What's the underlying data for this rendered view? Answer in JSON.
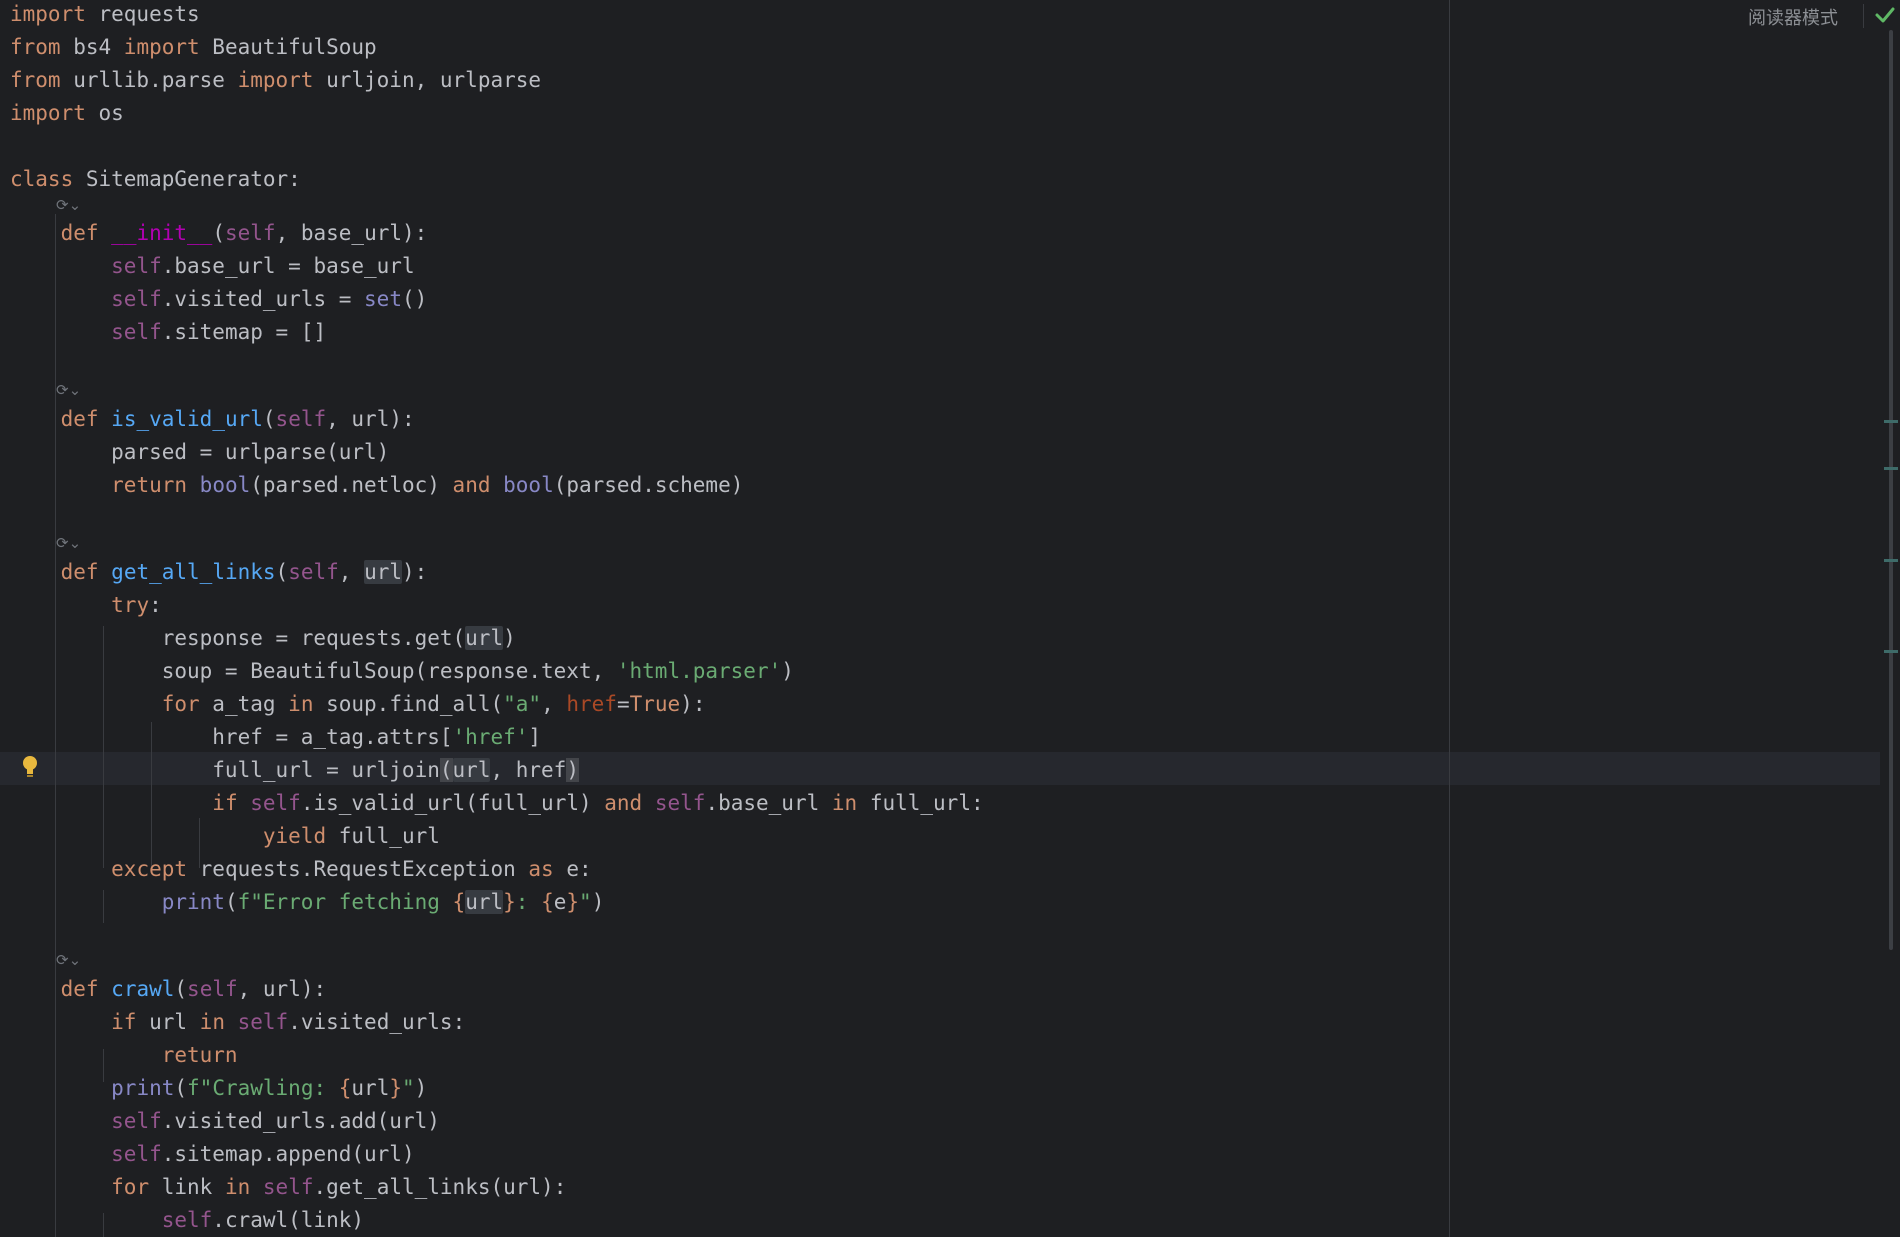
{
  "toolbar": {
    "reader_mode_label": "阅读器模式",
    "inspection_status_icon": "check-icon"
  },
  "colors": {
    "background": "#1e1f22",
    "keyword": "#cf8e6d",
    "self": "#94558d",
    "function": "#56a8f5",
    "magic": "#b200b2",
    "builtin": "#8888c6",
    "string": "#6aab73",
    "param": "#aa4926",
    "text": "#bcbec4"
  },
  "editor": {
    "gutter_icons": [
      "override-method-icon",
      "intention-bulb-icon"
    ],
    "lines": [
      [
        {
          "t": "import",
          "c": "kw"
        },
        {
          "t": " requests"
        }
      ],
      [
        {
          "t": "from",
          "c": "kw"
        },
        {
          "t": " bs4 "
        },
        {
          "t": "import",
          "c": "kw"
        },
        {
          "t": " BeautifulSoup"
        }
      ],
      [
        {
          "t": "from",
          "c": "kw"
        },
        {
          "t": " urllib.parse "
        },
        {
          "t": "import",
          "c": "kw"
        },
        {
          "t": " urljoin, urlparse"
        }
      ],
      [
        {
          "t": "import",
          "c": "kw"
        },
        {
          "t": " os"
        }
      ],
      [
        {
          "t": "class",
          "c": "kw"
        },
        {
          "t": " SitemapGenerator:"
        }
      ],
      [
        {
          "t": "    "
        },
        {
          "t": "def",
          "c": "kw"
        },
        {
          "t": " "
        },
        {
          "t": "__init__",
          "c": "magic"
        },
        {
          "t": "("
        },
        {
          "t": "self",
          "c": "self"
        },
        {
          "t": ", base_url):"
        }
      ],
      [
        {
          "t": "        "
        },
        {
          "t": "self",
          "c": "self"
        },
        {
          "t": ".base_url = base_url"
        }
      ],
      [
        {
          "t": "        "
        },
        {
          "t": "self",
          "c": "self"
        },
        {
          "t": ".visited_urls = "
        },
        {
          "t": "set",
          "c": "builtin"
        },
        {
          "t": "()"
        }
      ],
      [
        {
          "t": "        "
        },
        {
          "t": "self",
          "c": "self"
        },
        {
          "t": ".sitemap = []"
        }
      ],
      [
        {
          "t": "    "
        },
        {
          "t": "def",
          "c": "kw"
        },
        {
          "t": " "
        },
        {
          "t": "is_valid_url",
          "c": "fn"
        },
        {
          "t": "("
        },
        {
          "t": "self",
          "c": "self"
        },
        {
          "t": ", url):"
        }
      ],
      [
        {
          "t": "        parsed = urlparse(url)"
        }
      ],
      [
        {
          "t": "        "
        },
        {
          "t": "return",
          "c": "kw"
        },
        {
          "t": " "
        },
        {
          "t": "bool",
          "c": "builtin"
        },
        {
          "t": "(parsed.netloc) "
        },
        {
          "t": "and",
          "c": "kw"
        },
        {
          "t": " "
        },
        {
          "t": "bool",
          "c": "builtin"
        },
        {
          "t": "(parsed.scheme)"
        }
      ],
      [
        {
          "t": "    "
        },
        {
          "t": "def",
          "c": "kw"
        },
        {
          "t": " "
        },
        {
          "t": "get_all_links",
          "c": "fn"
        },
        {
          "t": "("
        },
        {
          "t": "self",
          "c": "self"
        },
        {
          "t": ", "
        },
        {
          "t": "url",
          "c": "hl"
        },
        {
          "t": "):"
        }
      ],
      [
        {
          "t": "        "
        },
        {
          "t": "try",
          "c": "kw"
        },
        {
          "t": ":"
        }
      ],
      [
        {
          "t": "            response = requests.get("
        },
        {
          "t": "url",
          "c": "hl"
        },
        {
          "t": ")"
        }
      ],
      [
        {
          "t": "            soup = BeautifulSoup(response.text, "
        },
        {
          "t": "'html.parser'",
          "c": "str"
        },
        {
          "t": ")"
        }
      ],
      [
        {
          "t": "            "
        },
        {
          "t": "for",
          "c": "kw"
        },
        {
          "t": " a_tag "
        },
        {
          "t": "in",
          "c": "kw"
        },
        {
          "t": " soup.find_all("
        },
        {
          "t": "\"a\"",
          "c": "str"
        },
        {
          "t": ", "
        },
        {
          "t": "href",
          "c": "param"
        },
        {
          "t": "="
        },
        {
          "t": "True",
          "c": "kw"
        },
        {
          "t": "):"
        }
      ],
      [
        {
          "t": "                href = a_tag.attrs["
        },
        {
          "t": "'href'",
          "c": "str"
        },
        {
          "t": "]"
        }
      ],
      [
        {
          "t": "                full_url = urljoin"
        },
        {
          "t": "(",
          "c": "brace"
        },
        {
          "t": "url",
          "c": "hl"
        },
        {
          "t": ", href"
        },
        {
          "t": ")",
          "c": "brace"
        }
      ],
      [
        {
          "t": "                "
        },
        {
          "t": "if",
          "c": "kw"
        },
        {
          "t": " "
        },
        {
          "t": "self",
          "c": "self"
        },
        {
          "t": ".is_valid_url(full_url) "
        },
        {
          "t": "and",
          "c": "kw"
        },
        {
          "t": " "
        },
        {
          "t": "self",
          "c": "self"
        },
        {
          "t": ".base_url "
        },
        {
          "t": "in",
          "c": "kw"
        },
        {
          "t": " full_url:"
        }
      ],
      [
        {
          "t": "                    "
        },
        {
          "t": "yield",
          "c": "kw"
        },
        {
          "t": " full_url"
        }
      ],
      [
        {
          "t": "        "
        },
        {
          "t": "except",
          "c": "kw"
        },
        {
          "t": " requests.RequestException "
        },
        {
          "t": "as",
          "c": "kw"
        },
        {
          "t": " e:"
        }
      ],
      [
        {
          "t": "            "
        },
        {
          "t": "print",
          "c": "builtin"
        },
        {
          "t": "("
        },
        {
          "t": "f\"Error fetching ",
          "c": "str"
        },
        {
          "t": "{",
          "c": "kw"
        },
        {
          "t": "url",
          "c": "hl"
        },
        {
          "t": "}",
          "c": "kw"
        },
        {
          "t": ": ",
          "c": "str"
        },
        {
          "t": "{",
          "c": "kw"
        },
        {
          "t": "e"
        },
        {
          "t": "}",
          "c": "kw"
        },
        {
          "t": "\"",
          "c": "str"
        },
        {
          "t": ")"
        }
      ],
      [
        {
          "t": "    "
        },
        {
          "t": "def",
          "c": "kw"
        },
        {
          "t": " "
        },
        {
          "t": "crawl",
          "c": "fn"
        },
        {
          "t": "("
        },
        {
          "t": "self",
          "c": "self"
        },
        {
          "t": ", url):"
        }
      ],
      [
        {
          "t": "        "
        },
        {
          "t": "if",
          "c": "kw"
        },
        {
          "t": " url "
        },
        {
          "t": "in",
          "c": "kw"
        },
        {
          "t": " "
        },
        {
          "t": "self",
          "c": "self"
        },
        {
          "t": ".visited_urls:"
        }
      ],
      [
        {
          "t": "            "
        },
        {
          "t": "return",
          "c": "kw"
        }
      ],
      [
        {
          "t": "        "
        },
        {
          "t": "print",
          "c": "builtin"
        },
        {
          "t": "("
        },
        {
          "t": "f\"Crawling: ",
          "c": "str"
        },
        {
          "t": "{",
          "c": "kw"
        },
        {
          "t": "url"
        },
        {
          "t": "}",
          "c": "kw"
        },
        {
          "t": "\"",
          "c": "str"
        },
        {
          "t": ")"
        }
      ],
      [
        {
          "t": "        "
        },
        {
          "t": "self",
          "c": "self"
        },
        {
          "t": ".visited_urls.add(url)"
        }
      ],
      [
        {
          "t": "        "
        },
        {
          "t": "self",
          "c": "self"
        },
        {
          "t": ".sitemap.append(url)"
        }
      ],
      [
        {
          "t": "        "
        },
        {
          "t": "for",
          "c": "kw"
        },
        {
          "t": " link "
        },
        {
          "t": "in",
          "c": "kw"
        },
        {
          "t": " "
        },
        {
          "t": "self",
          "c": "self"
        },
        {
          "t": ".get_all_links(url):"
        }
      ],
      [
        {
          "t": "            "
        },
        {
          "t": "self",
          "c": "self"
        },
        {
          "t": ".crawl(link)"
        }
      ]
    ]
  }
}
